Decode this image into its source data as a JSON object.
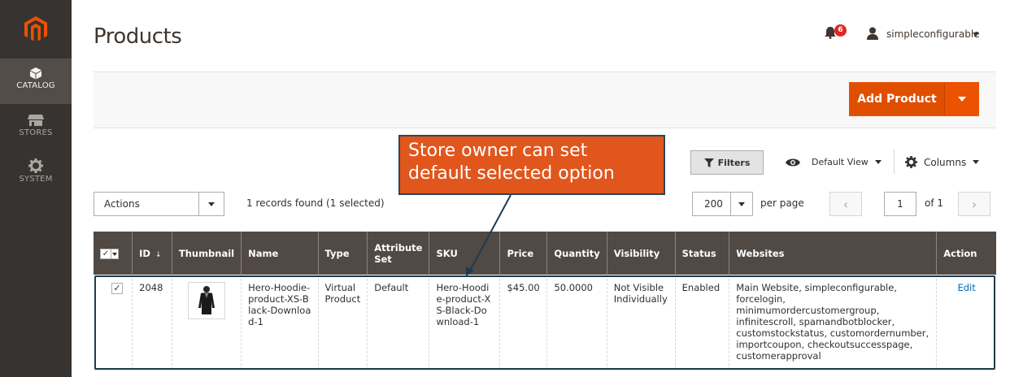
{
  "sidebar": {
    "logo": "magento-logo",
    "items": [
      {
        "label": "CATALOG",
        "icon": "cube-icon",
        "active": true
      },
      {
        "label": "STORES",
        "icon": "store-icon"
      },
      {
        "label": "SYSTEM",
        "icon": "gear-icon"
      }
    ]
  },
  "header": {
    "title": "Products",
    "notifications_count": "6",
    "user_name": "simpleconfigurable"
  },
  "action_bar": {
    "add_product_label": "Add Product"
  },
  "toolbar": {
    "filters_label": "Filters",
    "view_label": "Default View",
    "columns_label": "Columns",
    "actions_label": "Actions",
    "records_text": "1 records found (1 selected)",
    "per_page_value": "200",
    "per_page_label": "per page",
    "current_page": "1",
    "total_pages_text": "of 1"
  },
  "grid": {
    "columns": [
      "ID",
      "Thumbnail",
      "Name",
      "Type",
      "Attribute Set",
      "SKU",
      "Price",
      "Quantity",
      "Visibility",
      "Status",
      "Websites",
      "Action"
    ],
    "rows": [
      {
        "id": "2048",
        "name": "Hero-Hoodie-product-XS-Black-Download-1",
        "type": "Virtual Product",
        "attribute_set": "Default",
        "sku": "Hero-Hoodie-product-XS-Black-Download-1",
        "price": "$45.00",
        "quantity": "50.0000",
        "visibility": "Not Visible Individually",
        "status": "Enabled",
        "websites": "Main Website, simpleconfigurable, forcelogin, minimumordercustomergroup, infinitescroll, spamandbotblocker, customstockstatus, customordernumber, importcoupon, checkoutsuccesspage, customerapproval",
        "action": "Edit",
        "selected": true
      }
    ]
  },
  "callout": {
    "text": "Store owner can set default selected option"
  },
  "colors": {
    "sidebar": "#373330",
    "accent": "#eb5202",
    "grid_header": "#514943",
    "callout": "#e0561d",
    "link": "#006bb4"
  }
}
